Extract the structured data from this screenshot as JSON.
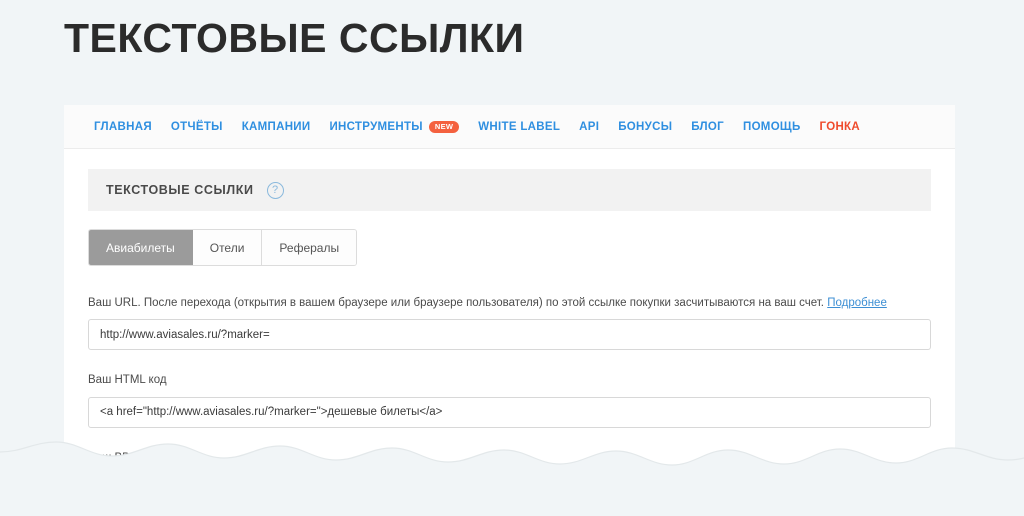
{
  "page": {
    "title": "ТЕКСТОВЫЕ ССЫЛКИ",
    "background_color": "#f1f5f7"
  },
  "nav": {
    "items": [
      {
        "label": "ГЛАВНАЯ",
        "accent": false,
        "badge": ""
      },
      {
        "label": "ОТЧЁТЫ",
        "accent": false,
        "badge": ""
      },
      {
        "label": "КАМПАНИИ",
        "accent": false,
        "badge": ""
      },
      {
        "label": "ИНСТРУМЕНТЫ",
        "accent": false,
        "badge": "NEW"
      },
      {
        "label": "WHITE LABEL",
        "accent": false,
        "badge": ""
      },
      {
        "label": "API",
        "accent": false,
        "badge": ""
      },
      {
        "label": "БОНУСЫ",
        "accent": false,
        "badge": ""
      },
      {
        "label": "БЛОГ",
        "accent": false,
        "badge": ""
      },
      {
        "label": "ПОМОЩЬ",
        "accent": false,
        "badge": ""
      },
      {
        "label": "ГОНКА",
        "accent": true,
        "badge": ""
      }
    ],
    "link_color": "#2f8fe0",
    "accent_color": "#ef4b2c",
    "badge_color": "#f4613f"
  },
  "section": {
    "title": "ТЕКСТОВЫЕ ССЫЛКИ",
    "help_icon": "question-mark-circle-icon",
    "help_glyph": "?"
  },
  "tabs": [
    {
      "label": "Авиабилеты",
      "active": true
    },
    {
      "label": "Отели",
      "active": false
    },
    {
      "label": "Рефералы",
      "active": false
    }
  ],
  "fields": {
    "url": {
      "label": "Ваш URL. После перехода (открытия в вашем браузере или браузере пользователя) по этой ссылке покупки засчитываются на ваш счет.",
      "more_link": "Подробнее",
      "value": "http://www.aviasales.ru/?marker="
    },
    "html": {
      "label": "Ваш HTML код",
      "value": "<a href=\"http://www.aviasales.ru/?marker=\">дешевые билеты</a>"
    },
    "bb": {
      "label": "Ваш BB код",
      "value": ""
    }
  }
}
